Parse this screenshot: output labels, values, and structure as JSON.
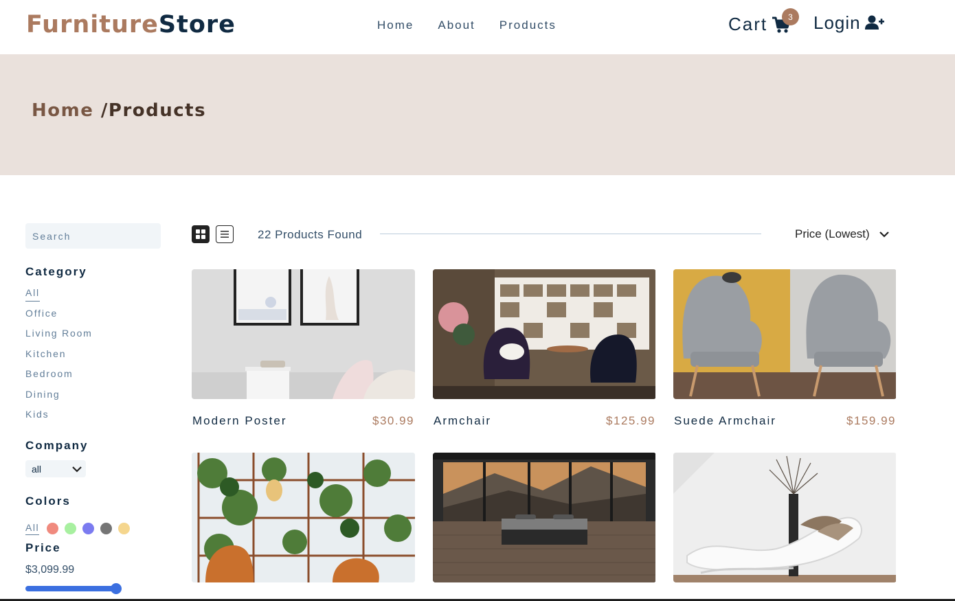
{
  "navbar": {
    "logo_part1": "Furniture",
    "logo_part2": "Store",
    "links": [
      "Home",
      "About",
      "Products"
    ],
    "cart_label": "Cart",
    "cart_count": "3",
    "login_label": "Login"
  },
  "hero": {
    "crumb_home": "Home ",
    "crumb_current": "/Products"
  },
  "filters": {
    "search_placeholder": "Search",
    "category_title": "Category",
    "categories": [
      "All",
      "Office",
      "Living Room",
      "Kitchen",
      "Bedroom",
      "Dining",
      "Kids"
    ],
    "company_title": "Company",
    "company_selected": "all",
    "colors_title": "Colors",
    "colors_all": "All",
    "colors": [
      "#f08a7e",
      "#a8f0a0",
      "#7b7bf0",
      "#757575",
      "#f5d68e"
    ],
    "price_title": "Price",
    "price_value": "$3,099.99",
    "price_fraction": 1.0
  },
  "products_header": {
    "found_text": "22 Products Found",
    "sort_selected": "Price (Lowest)"
  },
  "products": [
    {
      "name": "Modern Poster",
      "price": "$30.99"
    },
    {
      "name": "Armchair",
      "price": "$125.99"
    },
    {
      "name": "Suede Armchair",
      "price": "$159.99"
    },
    {
      "name": "",
      "price": ""
    },
    {
      "name": "",
      "price": ""
    },
    {
      "name": "",
      "price": ""
    }
  ],
  "colors": {
    "brand": "#ab7a5f",
    "dark": "#102a42",
    "hero_bg": "#eae1dc",
    "accent_blue": "#3b6fe0"
  }
}
